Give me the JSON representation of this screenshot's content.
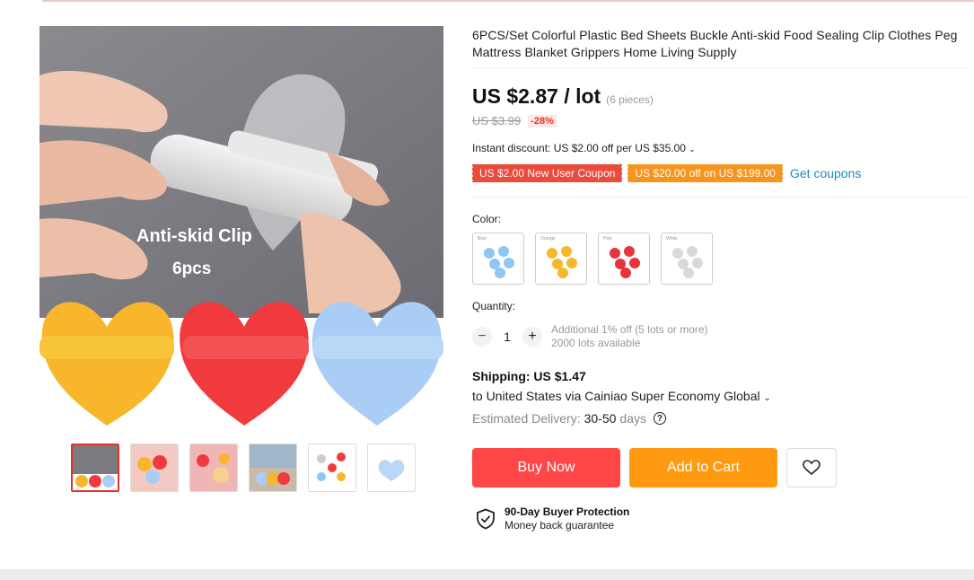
{
  "product": {
    "title": "6PCS/Set Colorful Plastic Bed Sheets Buckle Anti-skid Food Sealing Clip Clothes Peg Mattress Blanket Grippers Home Living Supply",
    "image_caption_line1": "Anti-skid Clip",
    "image_caption_line2": "6pcs"
  },
  "price": {
    "current": "US $2.87 / lot",
    "pieces": "(6 pieces)",
    "original": "US $3.99",
    "discount": "-28%"
  },
  "instant_discount": "Instant discount: US $2.00 off per US $35.00",
  "coupons": {
    "new_user": "US $2.00 New User Coupon",
    "spend_off": "US $20.00 off on US $199.00",
    "get_coupons": "Get coupons"
  },
  "color": {
    "label": "Color:",
    "options": [
      {
        "tag": "Blue",
        "color": "#8fc6f2"
      },
      {
        "tag": "Orange",
        "color": "#f5b82a"
      },
      {
        "tag": "Pink",
        "color": "#e8343b"
      },
      {
        "tag": "White",
        "color": "#d9d9d9"
      }
    ]
  },
  "quantity": {
    "label": "Quantity:",
    "value": "1",
    "minus": "−",
    "plus": "+",
    "note1": "Additional 1% off (5 lots or more)",
    "note2": "2000 lots available"
  },
  "shipping": {
    "title": "Shipping: US $1.47",
    "to": "to United States via Cainiao Super Economy Global",
    "est_label": "Estimated Delivery:",
    "est_value": "30-50",
    "est_unit": "days",
    "help": "?"
  },
  "actions": {
    "buy_now": "Buy Now",
    "add_to_cart": "Add to Cart"
  },
  "protection": {
    "title": "90-Day Buyer Protection",
    "subtitle": "Money back guarantee"
  },
  "colors": {
    "buy_now": "#ff4747",
    "add_to_cart": "#ff9a10",
    "coupon_red": "#ea4b3c",
    "coupon_orange": "#f7941d",
    "link": "#1a8bb8"
  }
}
